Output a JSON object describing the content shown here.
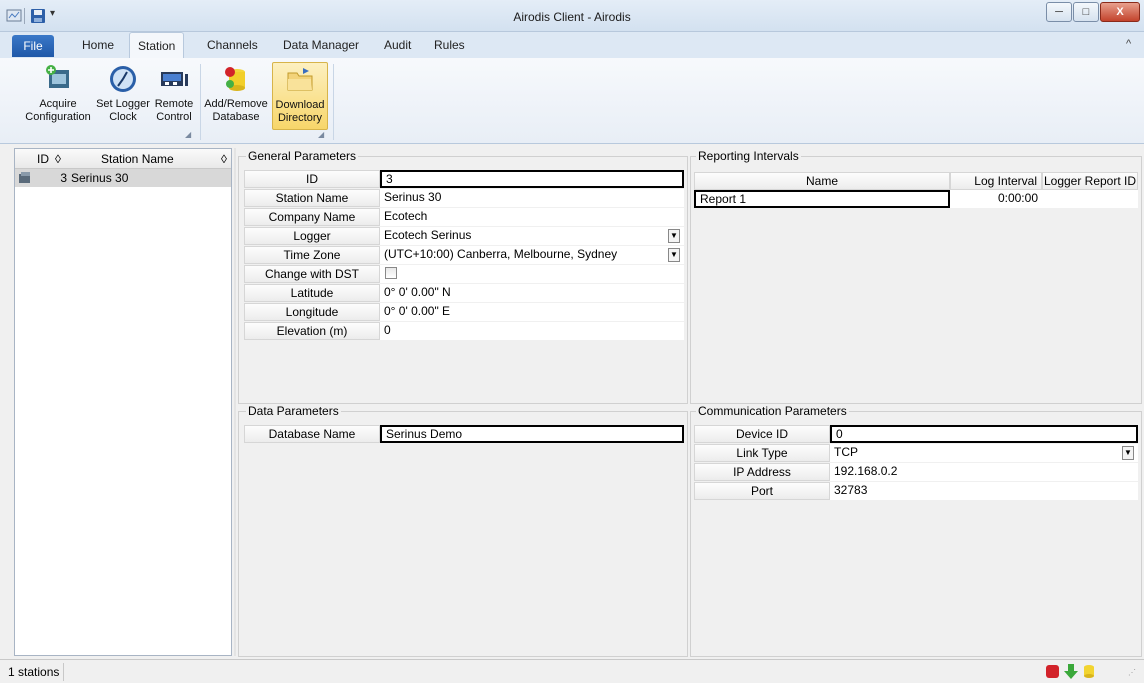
{
  "window": {
    "title": "Airodis Client - Airodis",
    "minimize_glyph": "─",
    "maximize_glyph": "□",
    "close_glyph": "X",
    "collapse_glyph": "^"
  },
  "tabs": {
    "file": "File",
    "home": "Home",
    "station": "Station",
    "channels": "Channels",
    "data_manager": "Data Manager",
    "audit": "Audit",
    "rules": "Rules"
  },
  "ribbon": {
    "acquire_1": "Acquire",
    "acquire_2": "Configuration",
    "setclock_1": "Set Logger",
    "setclock_2": "Clock",
    "remote_1": "Remote",
    "remote_2": "Control",
    "addremove_1": "Add/Remove",
    "addremove_2": "Database",
    "download_1": "Download",
    "download_2": "Directory"
  },
  "station_list": {
    "col_id": "ID",
    "col_name": "Station Name",
    "sort_glyph": "◊",
    "rows": [
      {
        "id": "3",
        "name": "Serinus 30"
      }
    ]
  },
  "general": {
    "title": "General Parameters",
    "fields": [
      {
        "label": "ID",
        "value": "3"
      },
      {
        "label": "Station Name",
        "value": "Serinus 30"
      },
      {
        "label": "Company Name",
        "value": "Ecotech"
      },
      {
        "label": "Logger",
        "value": "Ecotech Serinus"
      },
      {
        "label": "Time Zone",
        "value": "(UTC+10:00) Canberra, Melbourne, Sydney"
      },
      {
        "label": "Change with DST",
        "value": ""
      },
      {
        "label": "Latitude",
        "value": "0° 0' 0.00\" N"
      },
      {
        "label": "Longitude",
        "value": "0° 0' 0.00\" E"
      },
      {
        "label": "Elevation (m)",
        "value": "0"
      }
    ]
  },
  "reporting": {
    "title": "Reporting Intervals",
    "col_name": "Name",
    "col_interval": "Log Interval",
    "col_report_id": "Logger Report ID",
    "rows": [
      {
        "name": "Report 1",
        "interval": "0:00:00",
        "report_id": ""
      }
    ]
  },
  "data_params": {
    "title": "Data Parameters",
    "db_label": "Database Name",
    "db_value": "Serinus Demo"
  },
  "comm": {
    "title": "Communication Parameters",
    "fields": [
      {
        "label": "Device ID",
        "value": "0"
      },
      {
        "label": "Link Type",
        "value": "TCP"
      },
      {
        "label": "IP Address",
        "value": "192.168.0.2"
      },
      {
        "label": "Port",
        "value": "32783"
      }
    ]
  },
  "status": {
    "count": "1 stations"
  },
  "icons": {
    "accent": "#1f58a8",
    "status_red": "#d2232a",
    "status_green": "#3aa83a",
    "status_yellow": "#f2d430"
  }
}
